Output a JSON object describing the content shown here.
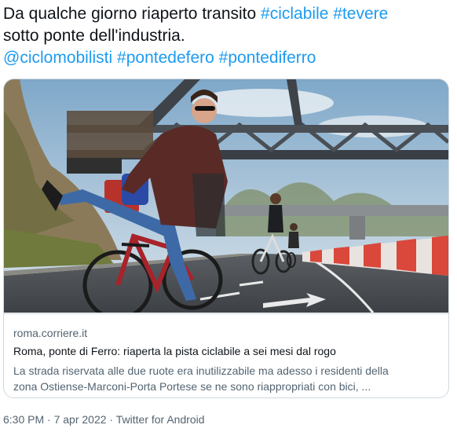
{
  "tweet": {
    "text_line1": "Da qualche giorno riaperto transito ",
    "hashtag_ciclabile": "#ciclabile",
    "hashtag_tevere": "#tevere",
    "text_line2": "sotto ponte dell'industria.",
    "mention_ciclomobilisti": "@ciclomobilisti",
    "hashtag_pontedefero": "#pontedefero",
    "hashtag_pontediferro": "#pontediferro"
  },
  "card": {
    "image_icon": "photo-bike-path-under-bridge",
    "domain": "roma.corriere.it",
    "title": "Roma, ponte di Ferro: riaperta la pista ciclabile a sei mesi dal rogo",
    "description_line1": "La strada riservata alle due ruote era inutilizzabile ma adesso i residenti della",
    "description_line2": "zona Ostiense-Marconi-Porta Portese se ne sono riappropriati con bici, ..."
  },
  "meta": {
    "time": "6:30 PM",
    "separator": " · ",
    "date": "7 apr 2022",
    "source": "Twitter for Android"
  },
  "colors": {
    "link": "#1d9bf0",
    "text": "#0f1419",
    "secondary": "#536471",
    "border": "#cfd9de"
  }
}
